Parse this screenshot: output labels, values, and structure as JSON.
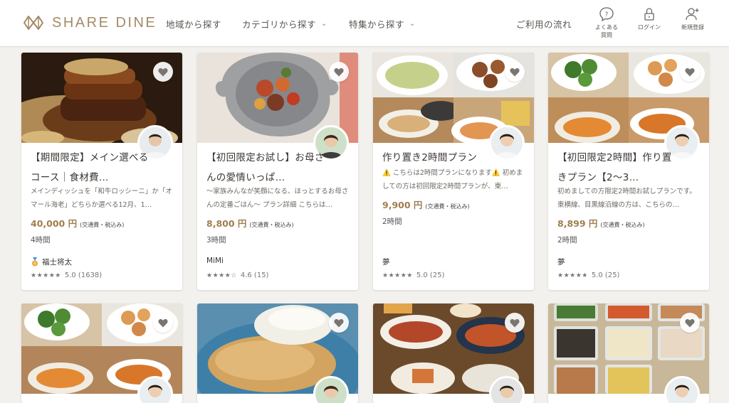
{
  "header": {
    "logo_text": "SHARE DINE",
    "nav": {
      "area": "地域から探す",
      "category": "カテゴリから探す",
      "feature": "特集から探す",
      "flow": "ご利用の流れ"
    },
    "faq_line1": "よくある",
    "faq_line2": "質問",
    "login": "ログイン",
    "signup": "新規登録"
  },
  "cards": [
    {
      "title": "【期間限定】メイン選べるコース｜食材費…",
      "desc": "メインディッシュを「和牛ロッシーニ」か「オマール海老」どちらか選べる12月、1…",
      "price": "40,000 円",
      "price_note": "(交通費・税込み)",
      "duration": "4時間",
      "host": "福士将太",
      "stars": "★★★★★",
      "rating": "5.0 (1638)"
    },
    {
      "title": "【初回限定お試し】お母さんの愛情いっぱ…",
      "desc": "〜家族みんなが笑顔になる、ほっとするお母さんの定番ごはん〜 プラン詳細 こちらは…",
      "price": "8,800 円",
      "price_note": "(交通費・税込み)",
      "duration": "3時間",
      "host": "MiMi",
      "stars": "★★★★☆",
      "rating": "4.6 (15)"
    },
    {
      "title": "作り置き2時間プラン",
      "desc": "⚠️ こちらは2時間プランになります⚠️ 初めましての方は初回限定2時間プランが、東…",
      "price": "9,900 円",
      "price_note": "(交通費・税込み)",
      "duration": "2時間",
      "host": "夢",
      "stars": "★★★★★",
      "rating": "5.0 (25)"
    },
    {
      "title": "【初回限定2時間】作り置きプラン【2〜3…",
      "desc": "初めましての方限定2時間お試しプランです。 東横線、目黒線沿線の方は、こちらの…",
      "price": "8,899 円",
      "price_note": "(交通費・税込み)",
      "duration": "2時間",
      "host": "夢",
      "stars": "★★★★★",
      "rating": "5.0 (25)"
    }
  ],
  "colors": {
    "brand": "#a48a66",
    "price": "#a07e4e",
    "background": "#f3f1ee"
  }
}
